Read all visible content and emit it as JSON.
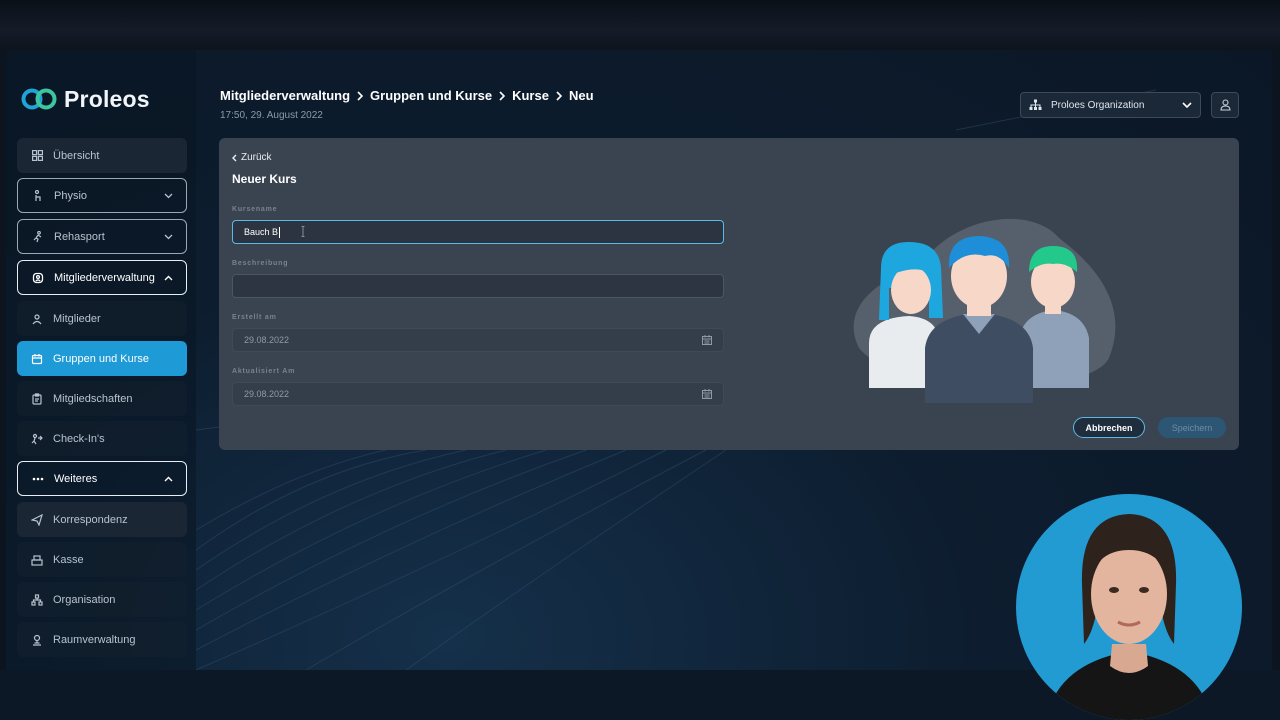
{
  "app": {
    "logo_text": "Proleos",
    "colors": {
      "accent": "#1e9ad6",
      "background": "#0d1d2f",
      "card": "#3a4451",
      "focus": "#5cb8e6"
    }
  },
  "sidebar": {
    "items": [
      {
        "label": "Übersicht",
        "icon": "grid-icon"
      },
      {
        "label": "Physio",
        "icon": "physio-icon"
      },
      {
        "label": "Rehasport",
        "icon": "running-icon"
      },
      {
        "label": "Mitgliederverwaltung",
        "icon": "members-icon"
      },
      {
        "label": "Mitglieder",
        "icon": "user-icon"
      },
      {
        "label": "Gruppen und Kurse",
        "icon": "calendar-icon"
      },
      {
        "label": "Mitgliedschaften",
        "icon": "clipboard-icon"
      },
      {
        "label": "Check-In's",
        "icon": "checkin-icon"
      },
      {
        "label": "Weiteres",
        "icon": "more-icon"
      },
      {
        "label": "Korrespondenz",
        "icon": "send-icon"
      },
      {
        "label": "Kasse",
        "icon": "register-icon"
      },
      {
        "label": "Organisation",
        "icon": "hierarchy-icon"
      },
      {
        "label": "Raumverwaltung",
        "icon": "room-icon"
      }
    ]
  },
  "header": {
    "breadcrumb": [
      "Mitgliederverwaltung",
      "Gruppen und Kurse",
      "Kurse",
      "Neu"
    ],
    "datetime": "17:50, 29. August 2022",
    "org_select": "Proloes Organization"
  },
  "form": {
    "back_label": "Zurück",
    "title": "Neuer Kurs",
    "fields": {
      "kursname": {
        "label": "Kursename",
        "value": "Bauch B"
      },
      "beschreibung": {
        "label": "Beschreibung",
        "value": ""
      },
      "erstellt": {
        "label": "Erstellt am",
        "value": "29.08.2022"
      },
      "aktualisiert": {
        "label": "Aktualisiert Am",
        "value": "29.08.2022"
      }
    },
    "cancel_label": "Abbrechen",
    "save_label": "Speichern"
  }
}
